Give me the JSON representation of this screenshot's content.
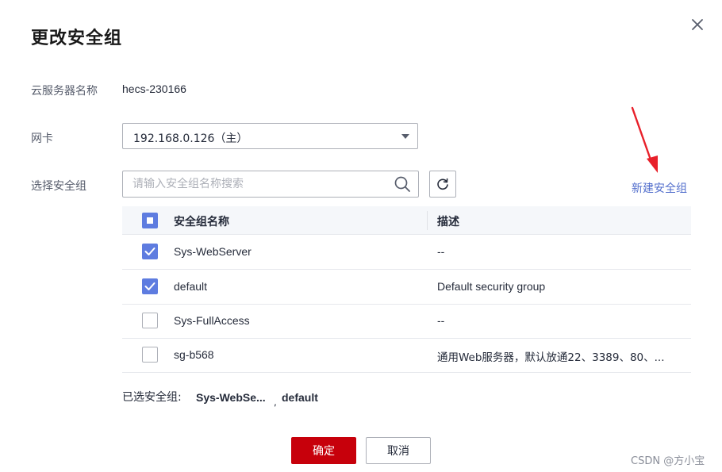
{
  "dialog": {
    "title": "更改安全组",
    "close_icon": "close-icon"
  },
  "server": {
    "label": "云服务器名称",
    "value": "hecs-230166"
  },
  "nic": {
    "label": "网卡",
    "selected": "192.168.0.126（主）"
  },
  "security_group": {
    "label": "选择安全组",
    "search_placeholder": "请输入安全组名称搜索",
    "search_value": "",
    "new_link": "新建安全组"
  },
  "table": {
    "columns": [
      "安全组名称",
      "描述"
    ],
    "header_checkbox": "partial",
    "rows": [
      {
        "name": "Sys-WebServer",
        "description": "--",
        "checked": true
      },
      {
        "name": "default",
        "description": "Default security group",
        "checked": true
      },
      {
        "name": "Sys-FullAccess",
        "description": "--",
        "checked": false
      },
      {
        "name": "sg-b568",
        "description": "通用Web服务器，默认放通22、3389、80、...",
        "checked": false
      }
    ]
  },
  "selected": {
    "label": "已选安全组:",
    "items": [
      "Sys-WebSe...",
      "default"
    ],
    "separator": ","
  },
  "buttons": {
    "confirm": "确定",
    "cancel": "取消"
  },
  "watermark": "CSDN @方小宝",
  "colors": {
    "primary_button": "#c7000b",
    "checkbox": "#5e7ce0",
    "link": "#526ecc",
    "annotation_arrow": "#e8202a"
  }
}
